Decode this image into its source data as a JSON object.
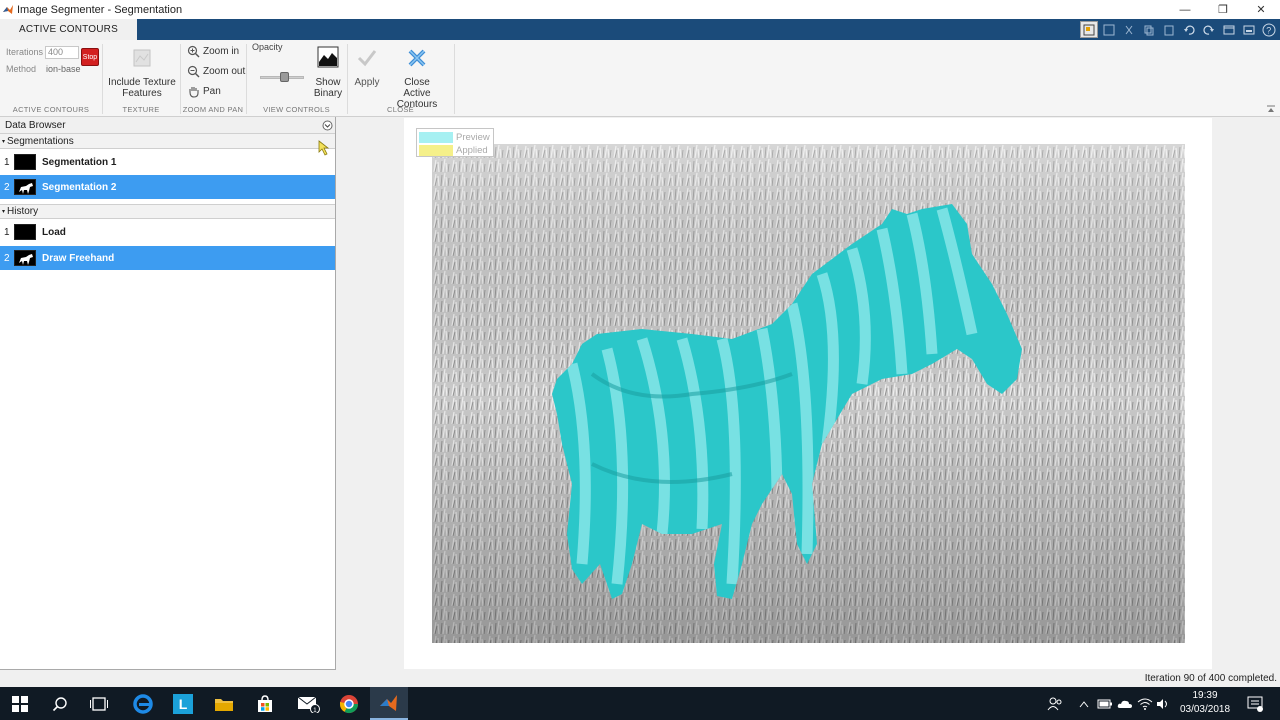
{
  "window": {
    "title": "Image Segmenter - Segmentation",
    "controls": [
      "minimize",
      "restore",
      "close"
    ]
  },
  "ribbon_tab": {
    "label": "ACTIVE CONTOURS"
  },
  "ribbon": {
    "active_contours": {
      "iterations_label": "Iterations",
      "iterations_value": "400",
      "method_label": "Method",
      "method_value": "ion-base",
      "stop_label": "Stop",
      "group_label": "ACTIVE CONTOURS"
    },
    "texture": {
      "button_label_1": "Include Texture",
      "button_label_2": "Features",
      "group_label": "TEXTURE"
    },
    "zoom_pan": {
      "zoom_in": "Zoom in",
      "zoom_out": "Zoom out",
      "pan": "Pan",
      "group_label": "ZOOM AND PAN"
    },
    "view_controls": {
      "opacity_label": "Opacity",
      "opacity_level": 0.55,
      "show_binary_1": "Show",
      "show_binary_2": "Binary",
      "group_label": "VIEW CONTROLS"
    },
    "close": {
      "apply": "Apply",
      "close_1": "Close",
      "close_2": "Active Contours",
      "group_label": "CLOSE"
    }
  },
  "data_browser": {
    "title": "Data Browser",
    "segmentations_header": "Segmentations",
    "segmentations": [
      {
        "index": "1",
        "name": "Segmentation 1",
        "selected": false
      },
      {
        "index": "2",
        "name": "Segmentation 2",
        "selected": true
      }
    ],
    "history_header": "History",
    "history": [
      {
        "index": "1",
        "name": "Load",
        "selected": false
      },
      {
        "index": "2",
        "name": "Draw Freehand",
        "selected": true
      }
    ]
  },
  "legend": {
    "preview": "Preview",
    "applied": "Applied",
    "preview_color": "#a6f0f2",
    "applied_color": "#f5f08a"
  },
  "status": {
    "text": "Iteration 90 of 400 completed."
  },
  "taskbar": {
    "time": "19:39",
    "date": "03/03/2018"
  },
  "colors": {
    "titlebar_tab_strip": "#1b4b7a",
    "selection": "#3d9cf1",
    "segmentation_overlay": "#2bc7c9",
    "taskbar": "#101a24"
  }
}
